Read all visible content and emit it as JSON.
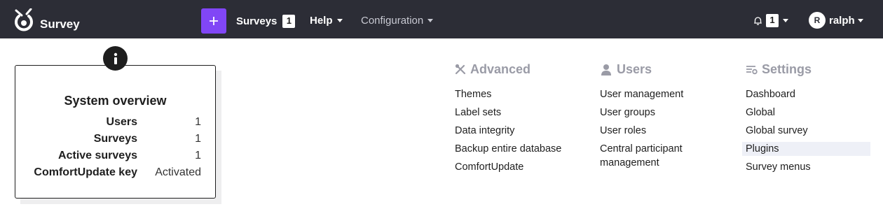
{
  "header": {
    "brand": "Survey",
    "brand_icon": "limesurvey-logo-icon",
    "add_button_icon": "plus-icon",
    "nav": {
      "surveys_label": "Surveys",
      "surveys_count": "1",
      "help_label": "Help",
      "configuration_label": "Configuration"
    },
    "notifications": {
      "icon": "bell-icon",
      "count": "1"
    },
    "user": {
      "avatar_initial": "R",
      "name": "ralph"
    }
  },
  "overview": {
    "title": "System overview",
    "info_icon": "info-icon",
    "rows": [
      {
        "label": "Users",
        "value": "1"
      },
      {
        "label": "Surveys",
        "value": "1"
      },
      {
        "label": "Active surveys",
        "value": "1"
      },
      {
        "label": "ComfortUpdate key",
        "value": "Activated"
      }
    ]
  },
  "menus": {
    "advanced": {
      "title": "Advanced",
      "icon": "tools-icon",
      "items": [
        "Themes",
        "Label sets",
        "Data integrity",
        "Backup entire database",
        "ComfortUpdate"
      ]
    },
    "users": {
      "title": "Users",
      "icon": "user-icon",
      "items": [
        "User management",
        "User groups",
        "User roles",
        "Central participant management"
      ]
    },
    "settings": {
      "title": "Settings",
      "icon": "settings-list-icon",
      "items": [
        "Dashboard",
        "Global",
        "Global survey",
        "Plugins",
        "Survey menus"
      ],
      "active_item": "Plugins"
    }
  },
  "colors": {
    "topbar": "#2c2d36",
    "accent": "#8146f6",
    "heading_muted": "#9a9ba6",
    "active_row": "#eef0f7"
  }
}
